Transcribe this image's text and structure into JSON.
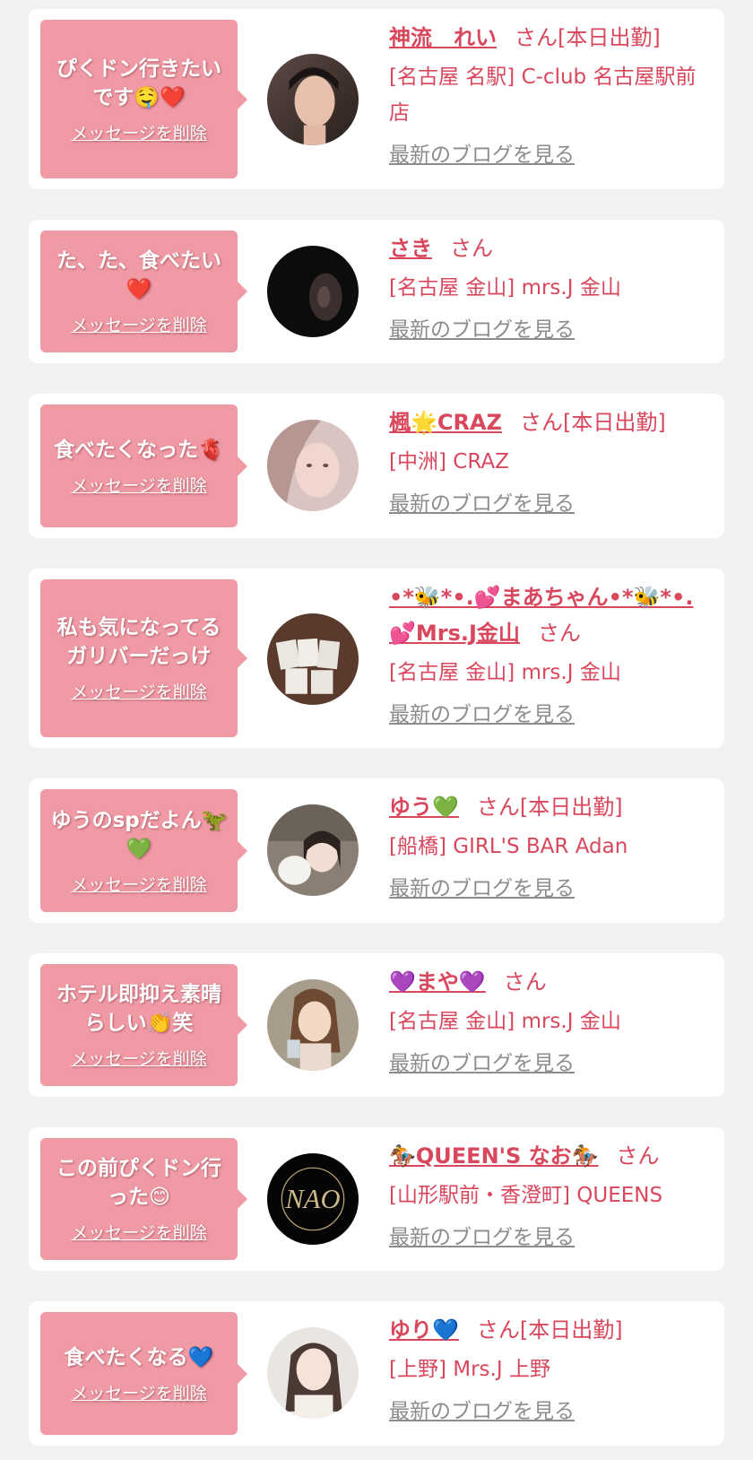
{
  "items": [
    {
      "message": "ぴくドン行きたいです🤤❤️",
      "delete_label": "メッセージを削除",
      "avatar": "avatar-photo-1",
      "name": "神流　れい",
      "honorific": "さん",
      "status": "[本日出勤]",
      "shop": "[名古屋 名駅] C-club 名古屋駅前店",
      "blog_label": "最新のブログを見る"
    },
    {
      "message": "た、た、食べたい❤️",
      "delete_label": "メッセージを削除",
      "avatar": "avatar-photo-2",
      "name": "さき",
      "honorific": "さん",
      "status": "",
      "shop": "[名古屋 金山] mrs.J 金山",
      "blog_label": "最新のブログを見る"
    },
    {
      "message": "食べたくなった🫀",
      "delete_label": "メッセージを削除",
      "avatar": "avatar-photo-3",
      "name": "楓🌟CRAZ",
      "honorific": "さん",
      "status": "[本日出勤]",
      "shop": "[中洲] CRAZ",
      "blog_label": "最新のブログを見る"
    },
    {
      "message": "私も気になってるガリバーだっけ",
      "delete_label": "メッセージを削除",
      "avatar": "avatar-photo-4",
      "name": "•*🐝*•.💕まあちゃん•*🐝*•.💕Mrs.J金山",
      "honorific": "さん",
      "status": "",
      "shop": "[名古屋 金山] mrs.J 金山",
      "blog_label": "最新のブログを見る"
    },
    {
      "message": "ゆうのspだよん🦖💚",
      "delete_label": "メッセージを削除",
      "avatar": "avatar-photo-5",
      "name": "ゆう💚",
      "honorific": "さん",
      "status": "[本日出勤]",
      "shop": "[船橋] GIRL'S BAR Adan",
      "blog_label": "最新のブログを見る"
    },
    {
      "message": "ホテル即抑え素晴らしい👏笑",
      "delete_label": "メッセージを削除",
      "avatar": "avatar-photo-6",
      "name": "💜まや💜",
      "honorific": "さん",
      "status": "",
      "shop": "[名古屋 金山] mrs.J 金山",
      "blog_label": "最新のブログを見る"
    },
    {
      "message": "この前ぴくドン行った😊",
      "delete_label": "メッセージを削除",
      "avatar": "avatar-logo-nao",
      "avatar_text": "NAO",
      "name": "🏇QUEEN'S なお🏇",
      "honorific": "さん",
      "status": "",
      "shop": "[山形駅前・香澄町] QUEENS",
      "blog_label": "最新のブログを見る"
    },
    {
      "message": "食べたくなる💙",
      "delete_label": "メッセージを削除",
      "avatar": "avatar-photo-8",
      "name": "ゆり💙",
      "honorific": "さん",
      "status": "[本日出勤]",
      "shop": "[上野] Mrs.J 上野",
      "blog_label": "最新のブログを見る"
    }
  ]
}
